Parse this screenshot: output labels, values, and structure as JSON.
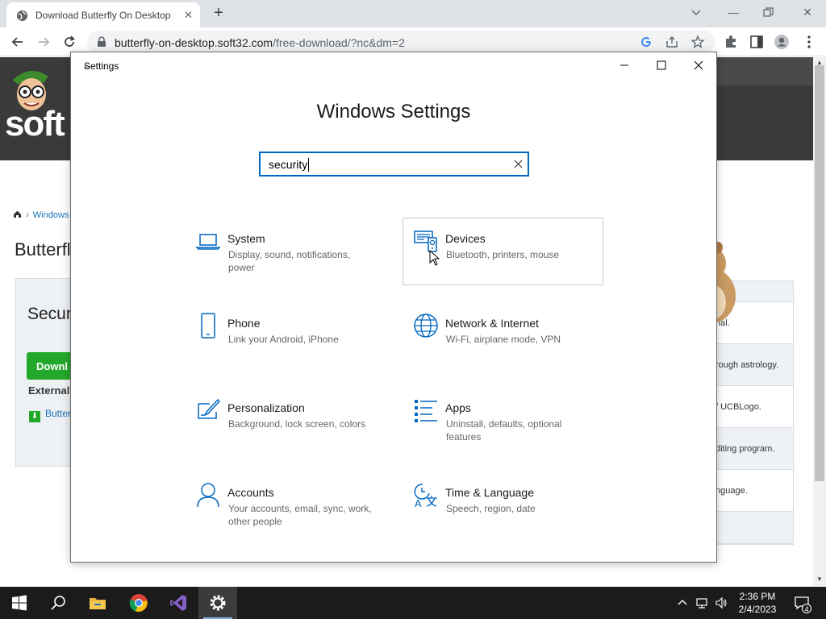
{
  "browser": {
    "tab_title": "Download Butterfly On Desktop",
    "new_tab": "+",
    "url_host": "butterfly-on-desktop.soft32.com",
    "url_path": "/free-download/?nc&dm=2"
  },
  "website": {
    "logo": "soft",
    "breadcrumb": "Windows",
    "title": "Butterfl",
    "panel_heading": "Secur",
    "download_button": "Downl",
    "external_label": "External",
    "external_link": "Butter",
    "side_items": [
      "nal.",
      "rough astrology.",
      "f UCBLogo.",
      "diting program.",
      "nguage."
    ]
  },
  "settings": {
    "app_title": "Settings",
    "heading": "Windows Settings",
    "search_value": "security",
    "tiles": [
      {
        "name": "System",
        "desc": "Display, sound, notifications, power",
        "icon": "laptop-icon"
      },
      {
        "name": "Devices",
        "desc": "Bluetooth, printers, mouse",
        "icon": "devices-icon"
      },
      {
        "name": "Phone",
        "desc": "Link your Android, iPhone",
        "icon": "phone-icon"
      },
      {
        "name": "Network & Internet",
        "desc": "Wi-Fi, airplane mode, VPN",
        "icon": "globe-icon"
      },
      {
        "name": "Personalization",
        "desc": "Background, lock screen, colors",
        "icon": "paint-icon"
      },
      {
        "name": "Apps",
        "desc": "Uninstall, defaults, optional features",
        "icon": "apps-list-icon"
      },
      {
        "name": "Accounts",
        "desc": "Your accounts, email, sync, work, other people",
        "icon": "person-icon"
      },
      {
        "name": "Time & Language",
        "desc": "Speech, region, date",
        "icon": "time-language-icon"
      }
    ],
    "accent": "#0067c0"
  },
  "taskbar": {
    "time": "2:36 PM",
    "date": "2/4/2023",
    "notification_count": "4"
  }
}
